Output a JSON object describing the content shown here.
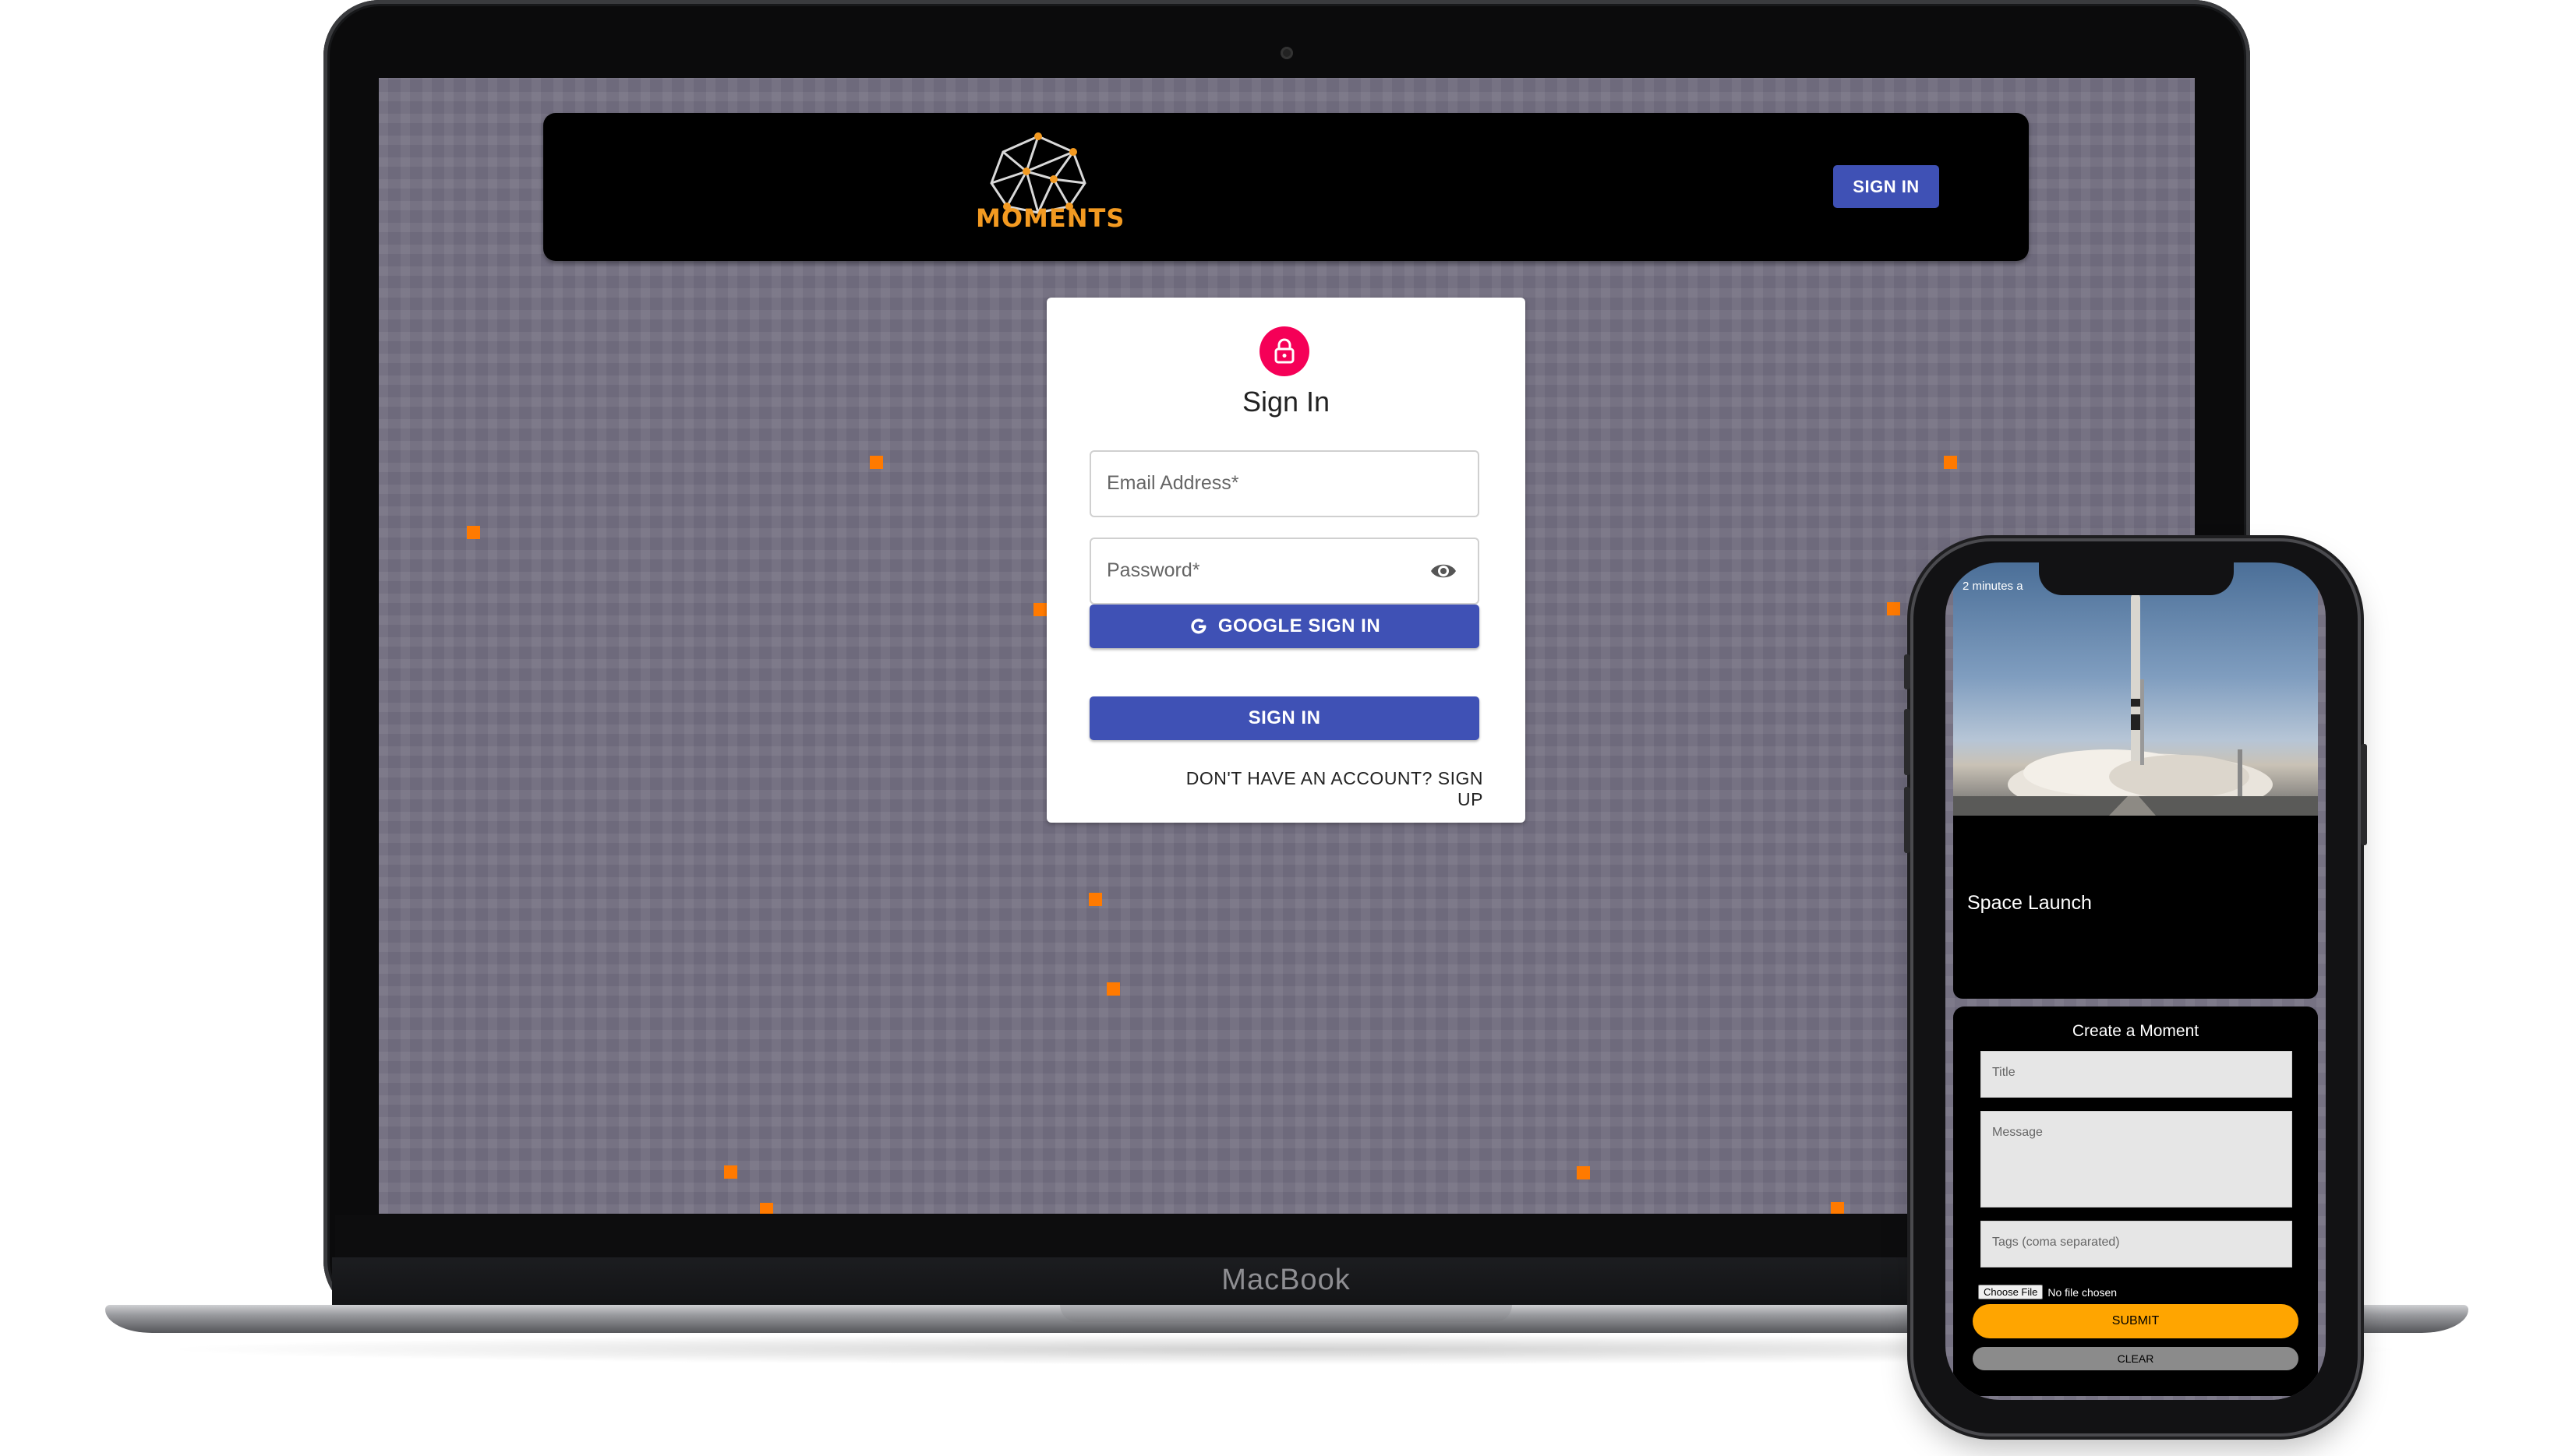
{
  "app": {
    "brand": "MOMENTS",
    "header_signin_label": "SIGN IN"
  },
  "signin_card": {
    "title": "Sign In",
    "email_label": "Email Address",
    "password_label": "Password",
    "required_mark": "*",
    "google_button_label": "GOOGLE SIGN IN",
    "signin_button_label": "SIGN IN",
    "signup_link": "DON'T HAVE AN ACCOUNT? SIGN UP"
  },
  "device": {
    "laptop_label": "MacBook"
  },
  "phone": {
    "moment": {
      "time": "2 minutes a",
      "title": "Space Launch"
    },
    "form": {
      "title": "Create a Moment",
      "title_placeholder": "Title",
      "message_placeholder": "Message",
      "tags_placeholder": "Tags (coma separated)",
      "file_button": "Choose File",
      "file_status": "No file chosen",
      "submit_label": "SUBMIT",
      "clear_label": "CLEAR"
    }
  },
  "colors": {
    "brand_orange": "#f39a21",
    "primary_blue": "#3f51b5",
    "lock_pink": "#f50057",
    "background_grid": "#6e6a7c",
    "submit_orange": "#ffa500"
  }
}
